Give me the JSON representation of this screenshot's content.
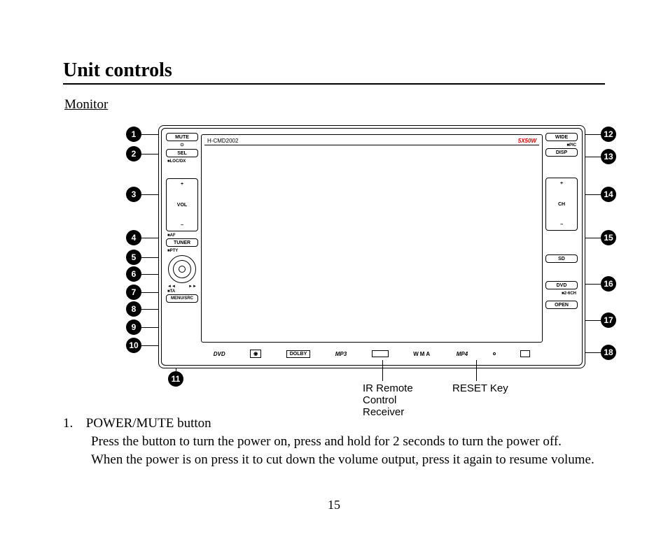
{
  "title": "Unit controls",
  "subtitle": "Monitor",
  "device": {
    "model": "H-CMD2002",
    "power_label": "5X50W",
    "left_buttons": {
      "mute": "MUTE",
      "power_sym": "⏻",
      "sel": "SEL",
      "locdx": "■LOC/DX",
      "vol_plus": "+",
      "vol_label": "VOL",
      "vol_minus": "−",
      "af": "■AF",
      "tuner": "TUNER",
      "pty": "■PTY",
      "ta": "■TA",
      "menu": "MENU/SRC",
      "knob_left": "◄◄",
      "knob_right": "►►"
    },
    "right_buttons": {
      "wide": "WIDE",
      "pic": "■PIC",
      "disp": "DISP",
      "ch_plus": "+",
      "ch_label": "CH",
      "ch_minus": "−",
      "sd": "SD",
      "dvd": "DVD",
      "ch26": "■2-6CH",
      "open": "OPEN"
    },
    "bottom_logos": {
      "dvd": "DVD",
      "disc": "◉",
      "dolby": "DOLBY",
      "mp3": "MP3",
      "wma": "WMA",
      "mp4": "MP4"
    }
  },
  "callouts": {
    "l1": "1",
    "l2": "2",
    "l3": "3",
    "l4": "4",
    "l5": "5",
    "l6": "6",
    "l7": "7",
    "l8": "8",
    "l9": "9",
    "l10": "10",
    "l11": "11",
    "r12": "12",
    "r13": "13",
    "r14": "14",
    "r15": "15",
    "r16": "16",
    "r17": "17",
    "r18": "18"
  },
  "annotations": {
    "ir": "IR Remote\nControl\nReceiver",
    "reset": "RESET Key"
  },
  "description": {
    "num": "1.",
    "heading": "POWER/MUTE button",
    "line1": "Press the button to turn the power on, press and hold for 2 seconds to turn the power off.",
    "line2": "When the power is on press it to cut down the volume output, press it again to resume volume."
  },
  "page_number": "15"
}
